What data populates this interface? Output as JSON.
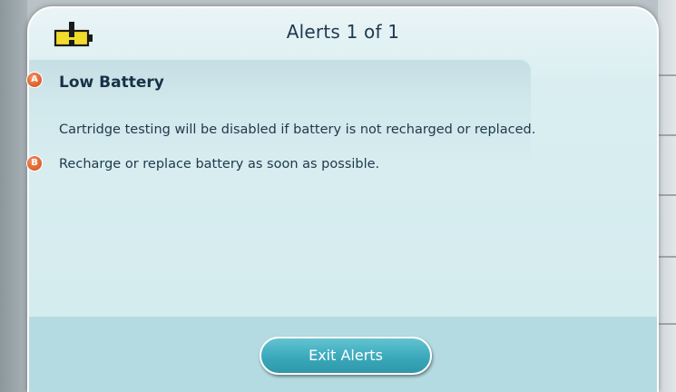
{
  "dialog": {
    "title": "Alerts 1 of 1",
    "icon": "low-battery-warning-icon"
  },
  "alert": {
    "title": "Low Battery",
    "message": "Cartridge testing will be disabled if battery is not recharged or replaced.",
    "action": "Recharge or replace battery as soon as possible."
  },
  "footer": {
    "exit_label": "Exit Alerts"
  },
  "callouts": {
    "a": "A",
    "b": "B"
  },
  "colors": {
    "accent": "#3aa9bb",
    "callout": "#e0642f",
    "battery": "#f2dc2b"
  }
}
